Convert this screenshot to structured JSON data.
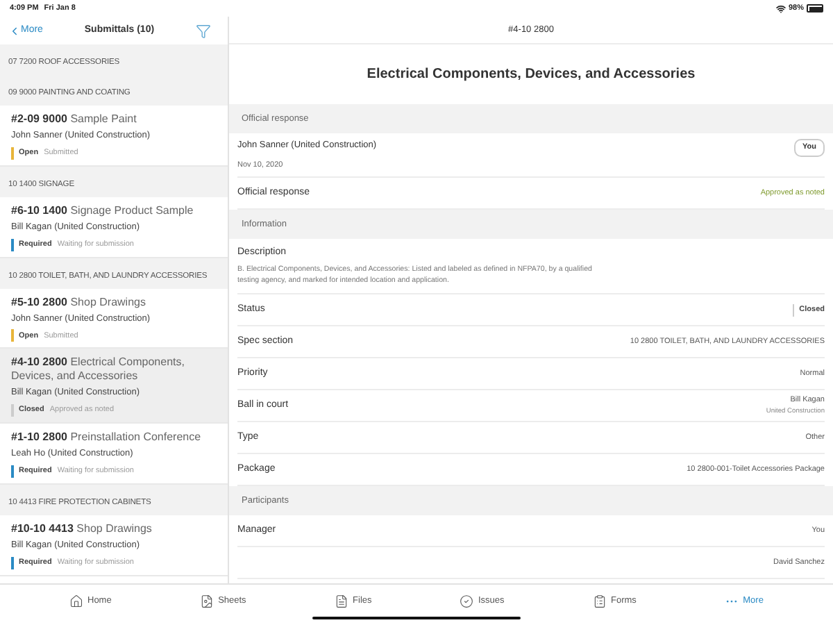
{
  "status_bar": {
    "time": "4:09 PM",
    "date": "Fri Jan 8",
    "battery": "98%"
  },
  "list_pane": {
    "back": "More",
    "title": "Submittals (10)",
    "items": [
      {
        "kind": "section",
        "title": "07 7200 ROOF ACCESSORIES"
      },
      {
        "kind": "section",
        "title": "09 9000 PAINTING AND COATING"
      },
      {
        "kind": "submittal",
        "number": "#2-09 9000",
        "title": "Sample Paint",
        "person": "John Sanner (United Construction)",
        "state": "Open",
        "color": "#e8b53a",
        "status": "Submitted",
        "selected": false
      },
      {
        "kind": "section",
        "title": "10 1400 SIGNAGE"
      },
      {
        "kind": "submittal",
        "number": "#6-10 1400",
        "title": "Signage Product Sample",
        "person": "Bill Kagan (United Construction)",
        "state": "Required",
        "color": "#2a8ac4",
        "status": "Waiting for submission",
        "selected": false
      },
      {
        "kind": "section",
        "title": "10 2800 TOILET, BATH, AND LAUNDRY ACCESSORIES"
      },
      {
        "kind": "submittal",
        "number": "#5-10 2800",
        "title": "Shop Drawings",
        "person": "John Sanner (United Construction)",
        "state": "Open",
        "color": "#e8b53a",
        "status": "Submitted",
        "selected": false
      },
      {
        "kind": "submittal",
        "number": "#4-10 2800",
        "title": "Electrical Components, Devices, and Accessories",
        "person": "Bill Kagan (United Construction)",
        "state": "Closed",
        "color": "#cccccc",
        "status": "Approved as noted",
        "selected": true
      },
      {
        "kind": "submittal",
        "number": "#1-10 2800",
        "title": "Preinstallation Conference",
        "person": "Leah Ho (United Construction)",
        "state": "Required",
        "color": "#2a8ac4",
        "status": "Waiting for submission",
        "selected": false
      },
      {
        "kind": "section",
        "title": "10 4413 FIRE PROTECTION CABINETS"
      },
      {
        "kind": "submittal",
        "number": "#10-10 4413",
        "title": "Shop Drawings",
        "person": "Bill Kagan (United Construction)",
        "state": "Required",
        "color": "#2a8ac4",
        "status": "Waiting for submission",
        "selected": false
      }
    ]
  },
  "detail": {
    "header": "#4-10 2800",
    "title": "Electrical Components, Devices, and Accessories",
    "sections": [
      {
        "title": "Official response",
        "rows": [
          {
            "kind": "responder",
            "name": "John Sanner (United Construction)",
            "date": "Nov 10, 2020",
            "badge": "You"
          },
          {
            "kind": "response",
            "label": "Official response",
            "value": "Approved as noted"
          }
        ]
      },
      {
        "title": "Information",
        "rows": [
          {
            "kind": "description",
            "label": "Description",
            "text": "B. Electrical Components, Devices, and Accessories: Listed and labeled as defined in NFPA70, by a qualified testing agency, and marked for intended location and application."
          },
          {
            "kind": "status",
            "label": "Status",
            "value": "Closed",
            "color": "#cccccc"
          },
          {
            "kind": "field",
            "label": "Spec section",
            "value": "10 2800 TOILET, BATH, AND LAUNDRY ACCESSORIES"
          },
          {
            "kind": "field",
            "label": "Priority",
            "value": "Normal"
          },
          {
            "kind": "person",
            "label": "Ball in court",
            "name": "Bill Kagan",
            "company": "United Construction"
          },
          {
            "kind": "field",
            "label": "Type",
            "value": "Other"
          },
          {
            "kind": "field",
            "label": "Package",
            "value": "10 2800-001-Toilet Accessories Package"
          }
        ]
      },
      {
        "title": "Participants",
        "rows": [
          {
            "kind": "field",
            "label": "Manager",
            "value": "You"
          },
          {
            "kind": "field",
            "value": "David Sanchez"
          }
        ]
      }
    ]
  },
  "tab_bar": [
    {
      "label": "Home",
      "selected": false
    },
    {
      "label": "Sheets",
      "selected": false
    },
    {
      "label": "Files",
      "selected": false
    },
    {
      "label": "Issues",
      "selected": false
    },
    {
      "label": "Forms",
      "selected": false
    },
    {
      "label": "More",
      "selected": true
    }
  ]
}
